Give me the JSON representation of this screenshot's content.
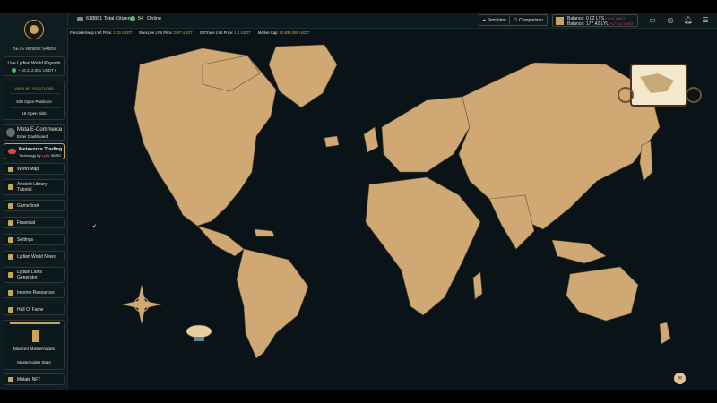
{
  "header": {
    "citizens": "618881 Total Citizens",
    "online_count": "54",
    "online_label": "Online",
    "simulator": "Simulator",
    "comparison": "Comparison",
    "balance_lys": "Balance: 0.02 LYS",
    "balance_lys_delta": "+0.01 USDT",
    "balance_lyl": "Balance: 177.42 LYL",
    "balance_lyl_delta": "+177.42 USDT"
  },
  "ticker": [
    {
      "label": "PancakeSwap LYS Price:",
      "value": "1.03 USDT"
    },
    {
      "label": "BitesLive LYS Price:",
      "value": "0.97 USDT"
    },
    {
      "label": "GSTrade LYS Price:",
      "value": "1.4 USDT"
    },
    {
      "label": "Market Cap:",
      "value": "90,838,086 USDT"
    }
  ],
  "sidebar": {
    "beta": "BETA Version: 6A889",
    "payouts_title": "Live Lydian World Payouts",
    "payouts_value": "~ 18,213,951 USDT",
    "positions_header": "VIEW MY POSITIONS",
    "open_positions": "530 Open Positions",
    "open_bids": "16 Open Bids",
    "meta_title": "Meta E-Commerce",
    "meta_sub": "Enter Dashboard",
    "mt_title": "Metaverse Trading",
    "mt_sub_prefix": "Technology By",
    "mt_sub_brand": "Lyds",
    "mt_sub_suffix": "XBIRD",
    "items": [
      {
        "label": "World Map"
      },
      {
        "label": "Ancient Library Tutorial"
      },
      {
        "label": "GameBook"
      },
      {
        "label": "Financial"
      },
      {
        "label": "Settings"
      },
      {
        "label": "Lydian World News"
      },
      {
        "label": "Lydian Lions Generator"
      },
      {
        "label": "Income Resources"
      },
      {
        "label": "Hall Of Fame"
      }
    ],
    "masternodes": "Mainnet Masternodes",
    "masternodes_stats": "Masternodes Stats",
    "mutate": "Mutate NFT"
  },
  "colors": {
    "land": "#cfa874",
    "sea": "#0a1418",
    "accent": "#c9a45a"
  }
}
